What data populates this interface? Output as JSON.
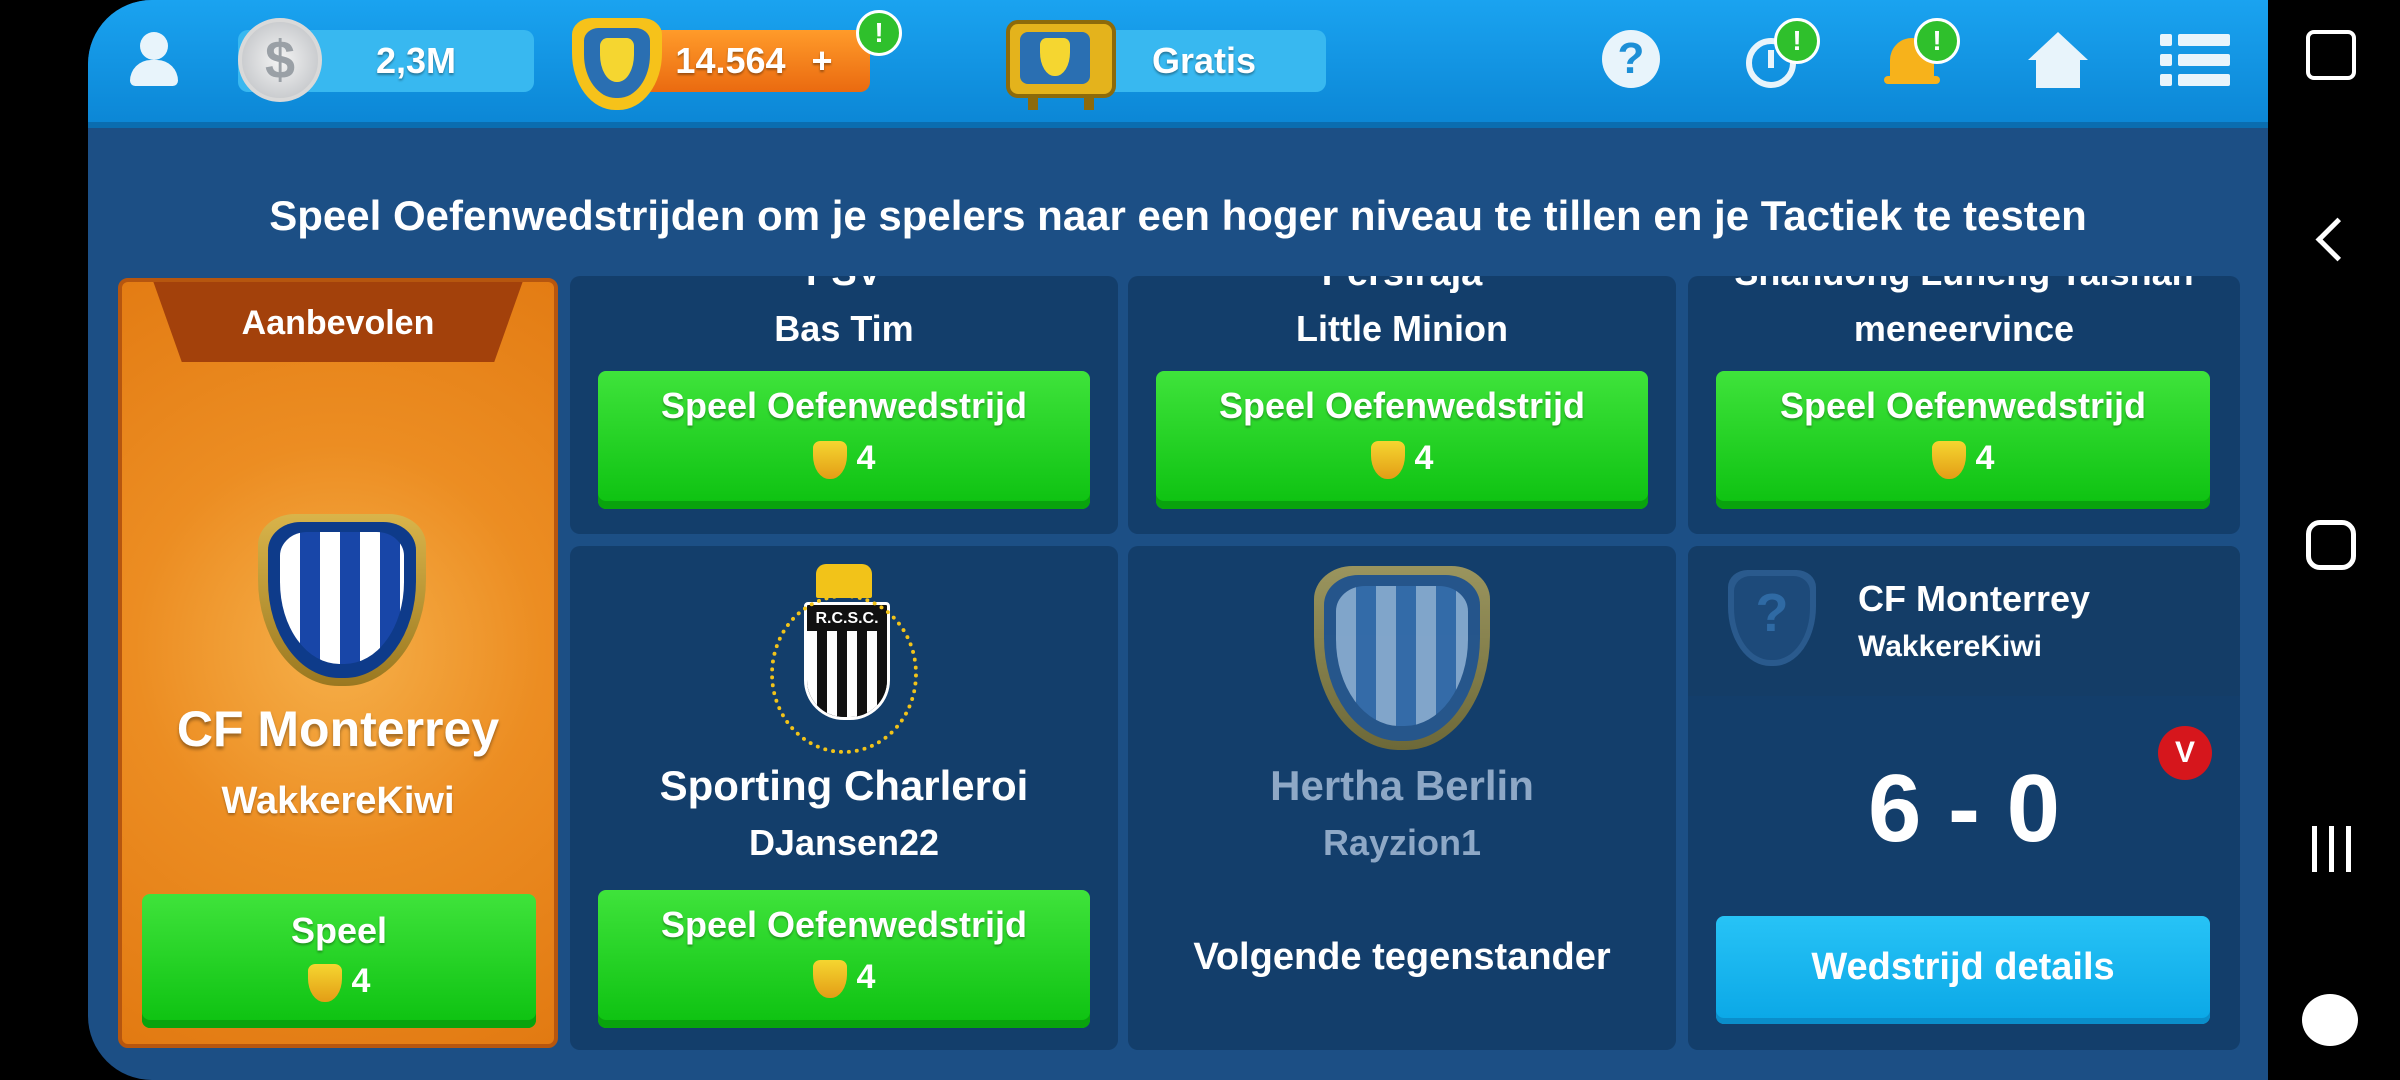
{
  "topbar": {
    "coins": "2,3M",
    "tokens": "14.564",
    "tokens_plus": "+",
    "tv_label": "Gratis",
    "badge_mark": "!"
  },
  "subtitle": "Speel Oefenwedstrijden om je spelers naar een hoger niveau te tillen en je Tactiek te testen",
  "featured": {
    "ribbon": "Aanbevolen",
    "club": "CF Monterrey",
    "manager": "WakkereKiwi",
    "button_label": "Speel",
    "cost": "4"
  },
  "top_cards": [
    {
      "club_partial": "PSV",
      "manager": "Bas Tim",
      "button_label": "Speel Oefenwedstrijd",
      "cost": "4"
    },
    {
      "club_partial": "Persiraja",
      "manager": "Little Minion",
      "button_label": "Speel Oefenwedstrijd",
      "cost": "4"
    },
    {
      "club_partial": "Shandong Luneng Taishan",
      "manager": "meneervince",
      "button_label": "Speel Oefenwedstrijd",
      "cost": "4"
    }
  ],
  "charleroi": {
    "crest_text": "R.C.S.C.",
    "club": "Sporting Charleroi",
    "manager": "DJansen22",
    "button_label": "Speel Oefenwedstrijd",
    "cost": "4"
  },
  "next_opponent": {
    "club": "Hertha Berlin",
    "manager": "Rayzion1",
    "label": "Volgende tegenstander"
  },
  "result": {
    "club": "CF Monterrey",
    "manager": "WakkereKiwi",
    "unknown_mark": "?",
    "outcome_badge": "V",
    "score": "6 - 0",
    "button_label": "Wedstrijd details"
  },
  "colors": {
    "topbar": "#1aa3f0",
    "background": "#1c4f85",
    "card": "#133e6b",
    "green_button": "#16c915",
    "blue_button": "#12b4ef",
    "featured": "#e8851a",
    "ribbon": "#a3410b",
    "win_badge": "#d6161c"
  },
  "icons": [
    "profile-icon",
    "coin-icon",
    "token-shield-icon",
    "tv-icon",
    "help-icon",
    "stopwatch-icon",
    "bell-icon",
    "home-icon",
    "menu-icon",
    "gamepad-lock-icon",
    "back-icon",
    "home-circle-icon",
    "recents-icon",
    "game-tools-icon"
  ]
}
